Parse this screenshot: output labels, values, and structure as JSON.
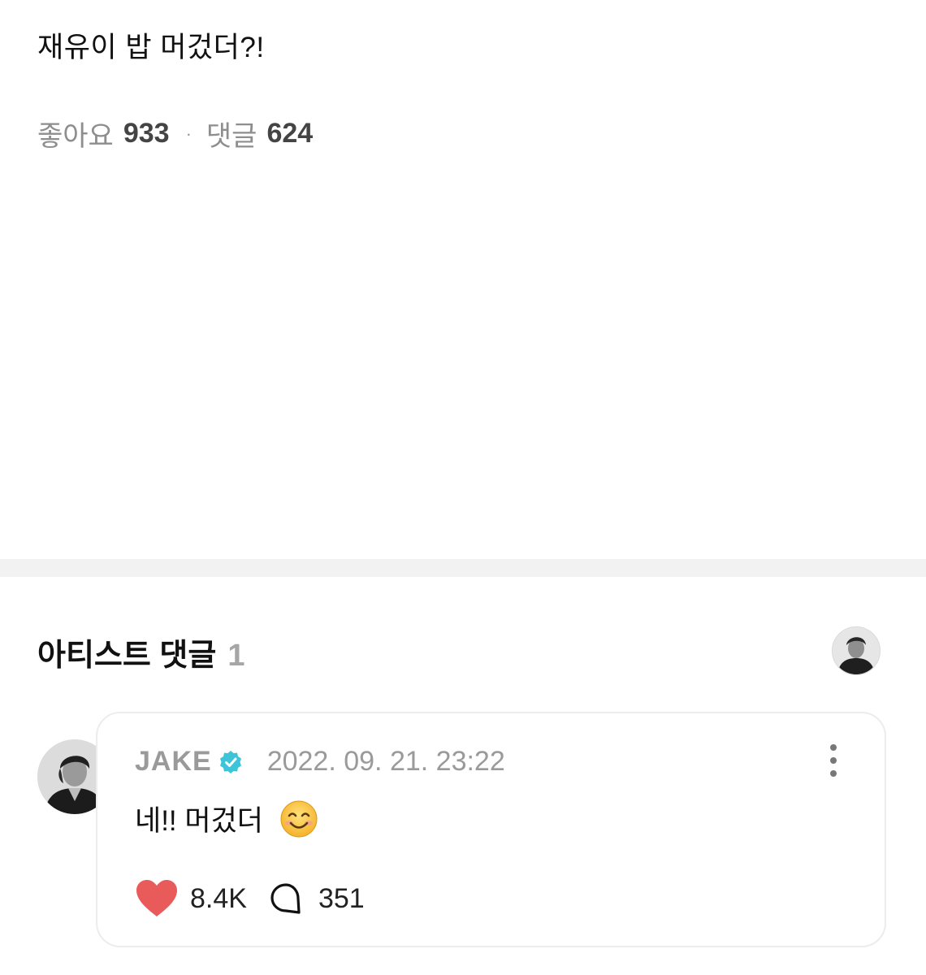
{
  "post": {
    "text": "재유이 밥 머겄더?!",
    "likes_label": "좋아요",
    "likes_count": "933",
    "separator": "·",
    "comments_label": "댓글",
    "comments_count": "624"
  },
  "artist_comments": {
    "title": "아티스트 댓글",
    "count": "1"
  },
  "comment": {
    "author": "JAKE",
    "timestamp": "2022. 09. 21. 23:22",
    "text": "네!! 머겄더",
    "emoji": "smiling-face-icon",
    "like_count": "8.4K",
    "reply_count": "351"
  },
  "colors": {
    "heart": "#e95a5a",
    "verified": "#3cc4d8",
    "divider": "#f2f2f2"
  }
}
